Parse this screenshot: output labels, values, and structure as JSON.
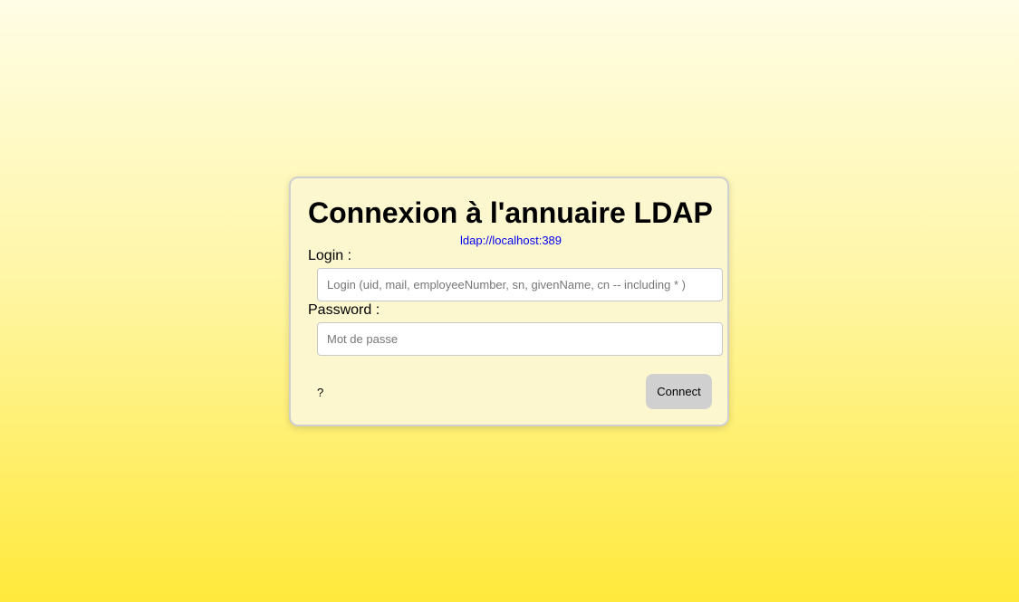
{
  "login_form": {
    "title": "Connexion à l'annuaire LDAP",
    "server_url": "ldap://localhost:389",
    "login_label": "Login :",
    "login_value": "",
    "login_placeholder": "Login (uid, mail, employeeNumber, sn, givenName, cn -- including * )",
    "password_label": "Password :",
    "password_value": "",
    "password_placeholder": "Mot de passe",
    "help_label": "?",
    "connect_label": "Connect"
  },
  "colors": {
    "background_top": "#fffde6",
    "background_bottom": "#ffe93b",
    "card_background": "#fdf7cf",
    "link": "#0000ee",
    "button": "#d0d0d0"
  }
}
